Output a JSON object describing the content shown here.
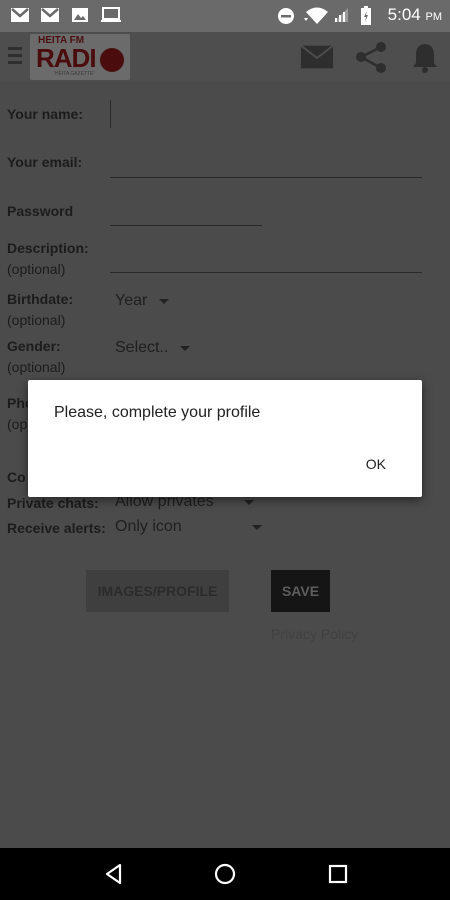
{
  "status_bar": {
    "time": "5:04",
    "ampm": "PM",
    "left_icons": [
      "gmail-icon",
      "gmail-icon",
      "image-icon",
      "laptop-icon"
    ],
    "right_icons": [
      "do-not-disturb-icon",
      "wifi-icon",
      "signal-icon",
      "battery-icon"
    ]
  },
  "app_bar": {
    "logo": {
      "top": "HEITA FM",
      "main": "RADI",
      "tagline": "'HEITA GAZETTE'"
    },
    "actions": [
      "mail-icon",
      "share-icon",
      "bell-icon"
    ]
  },
  "form": {
    "name_label": "Your name:",
    "email_label": "Your email:",
    "password_label": "Password",
    "description_label": "Description:",
    "description_sub": "(optional)",
    "birthdate_label": "Birthdate:",
    "birthdate_sub": "(optional)",
    "birthdate_value": "Year",
    "gender_label": "Gender:",
    "gender_sub": "(optional)",
    "gender_value": "Select..",
    "phone_label_partial": "Pho",
    "phone_sub_partial": "(op",
    "country_label_partial": "Co",
    "private_chats_label": "Private chats:",
    "private_chats_value": "Allow privates",
    "receive_alerts_label": "Receive alerts:",
    "receive_alerts_value": "Only icon",
    "images_button": "IMAGES/PROFILE",
    "save_button": "SAVE",
    "privacy_link": "Privacy Policy"
  },
  "dialog": {
    "message": "Please, complete your profile",
    "ok": "OK"
  },
  "nav_bar": {
    "buttons": [
      "back-icon",
      "home-icon",
      "recents-icon"
    ]
  }
}
